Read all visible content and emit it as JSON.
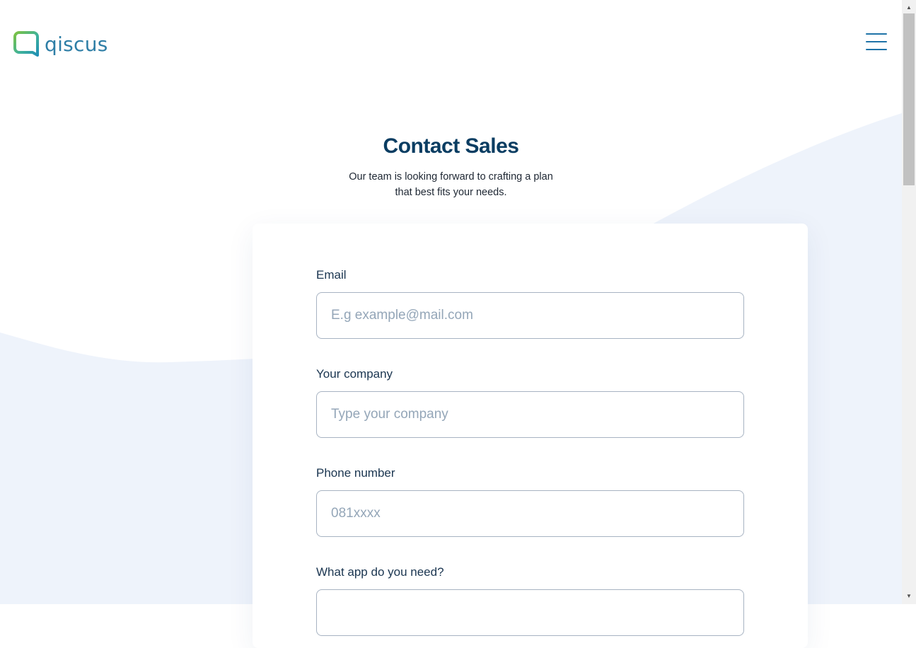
{
  "brand": {
    "name": "qiscus",
    "logo_icon": "chat-bubble-icon",
    "colors": {
      "primary": "#2e7ea6",
      "green": "#6cc04a",
      "heading": "#0a3d62"
    }
  },
  "header": {
    "menu_icon": "hamburger-icon"
  },
  "page": {
    "title": "Contact Sales",
    "subtitle": "Our team is looking forward to crafting a plan that best fits your needs."
  },
  "form": {
    "email": {
      "label": "Email",
      "placeholder": "E.g example@mail.com",
      "value": ""
    },
    "company": {
      "label": "Your company",
      "placeholder": "Type your company",
      "value": ""
    },
    "phone": {
      "label": "Phone number",
      "placeholder": "081xxxx",
      "value": ""
    },
    "app": {
      "label": "What app do you need?"
    }
  }
}
